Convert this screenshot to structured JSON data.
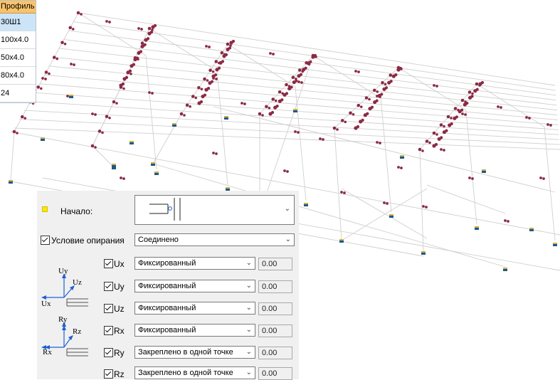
{
  "profile_table": {
    "header": "Профиль",
    "rows": [
      "30Ш1",
      "100x4.0",
      "50x4.0",
      "80x4.0",
      "24"
    ]
  },
  "panel": {
    "start_label": "Начало:",
    "support_condition_label": "Условие опирания",
    "support_condition_value": "Соединено",
    "dofs": [
      {
        "label": "Ux",
        "value": "Фиксированный",
        "number": "0.00"
      },
      {
        "label": "Uy",
        "value": "Фиксированный",
        "number": "0.00"
      },
      {
        "label": "Uz",
        "value": "Фиксированный",
        "number": "0.00"
      },
      {
        "label": "Rx",
        "value": "Фиксированный",
        "number": "0.00"
      },
      {
        "label": "Ry",
        "value": "Закреплено в одной точке",
        "number": "0.00"
      },
      {
        "label": "Rz",
        "value": "Закреплено в одной точке",
        "number": "0.00"
      }
    ],
    "translation_diagram": {
      "uy": "Uy",
      "uz": "Uz",
      "ux": "Ux"
    },
    "rotation_diagram": {
      "ry": "Ry",
      "rz": "Rz",
      "rx": "Rx"
    }
  },
  "colors": {
    "profile_header": "#f8c36b",
    "selected_row": "#cce4f7",
    "node": "#8b2a45",
    "axis_blue": "#1f5fd1",
    "support_marker": "#1a5a8a"
  }
}
